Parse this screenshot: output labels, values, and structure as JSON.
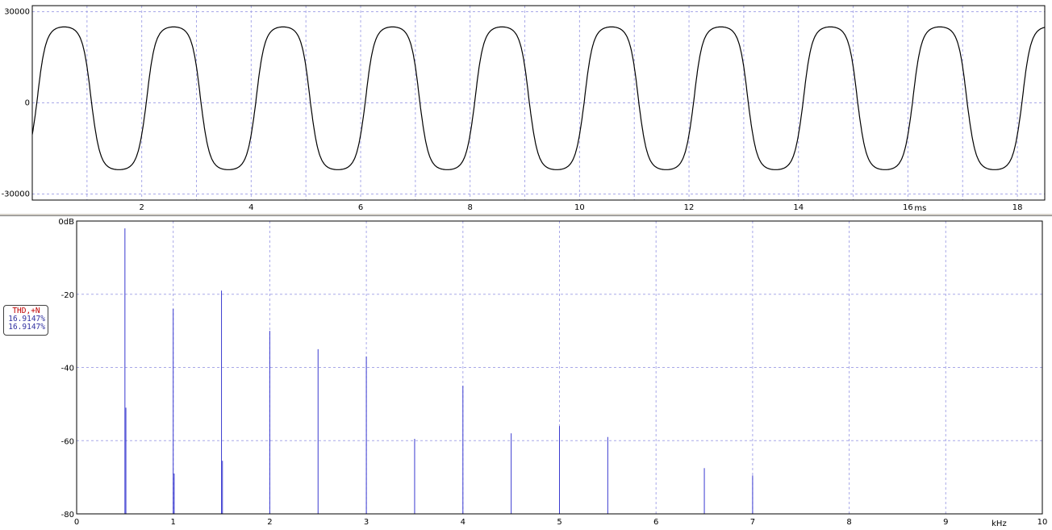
{
  "colors": {
    "waveform": "#000000",
    "spectrum": "#3a3ad0",
    "grid": "#a8a8e8",
    "thd_label": "#c00000",
    "thd_value": "#3030a0"
  },
  "thd": {
    "label": "THD,+N",
    "value1": "16.9147%",
    "value2": "16.9147%"
  },
  "chart_data": [
    {
      "type": "line",
      "x_unit_label": "ms",
      "xlim": [
        0,
        18.5
      ],
      "ylim": [
        -32000,
        32000
      ],
      "x_ticks": [
        2,
        4,
        6,
        8,
        10,
        12,
        14,
        16,
        18
      ],
      "y_ticks": [
        30000,
        0,
        -30000
      ],
      "y_tick_labels": [
        "30000",
        "0",
        "-30000"
      ],
      "grid": true,
      "series": [
        {
          "frequency_hz": 500,
          "peak_high": 25000,
          "peak_low": -22000,
          "shape": "clipped sine",
          "phase_ms": 0.083
        }
      ]
    },
    {
      "type": "bar",
      "x_unit_label": "kHz",
      "y_top_label": "0dB",
      "xlim": [
        0,
        10
      ],
      "ylim": [
        -80,
        0
      ],
      "x_ticks": [
        0,
        1,
        2,
        3,
        4,
        5,
        6,
        7,
        8,
        9,
        10
      ],
      "y_ticks": [
        0,
        -20,
        -40,
        -60,
        -80
      ],
      "y_tick_labels": [
        "0dB",
        "-20",
        "-40",
        "-60",
        "-80"
      ],
      "grid": true,
      "lines": [
        {
          "x": 0.5,
          "y": -2
        },
        {
          "x": 0.51,
          "y": -51
        },
        {
          "x": 1.0,
          "y": -24
        },
        {
          "x": 1.01,
          "y": -69
        },
        {
          "x": 1.5,
          "y": -19
        },
        {
          "x": 1.51,
          "y": -65.5
        },
        {
          "x": 2.0,
          "y": -30
        },
        {
          "x": 2.5,
          "y": -35
        },
        {
          "x": 3.0,
          "y": -37
        },
        {
          "x": 3.5,
          "y": -59.5
        },
        {
          "x": 4.0,
          "y": -45
        },
        {
          "x": 4.5,
          "y": -58
        },
        {
          "x": 5.0,
          "y": -56
        },
        {
          "x": 5.5,
          "y": -59
        },
        {
          "x": 6.5,
          "y": -67.5
        },
        {
          "x": 7.0,
          "y": -69.5
        }
      ]
    }
  ]
}
